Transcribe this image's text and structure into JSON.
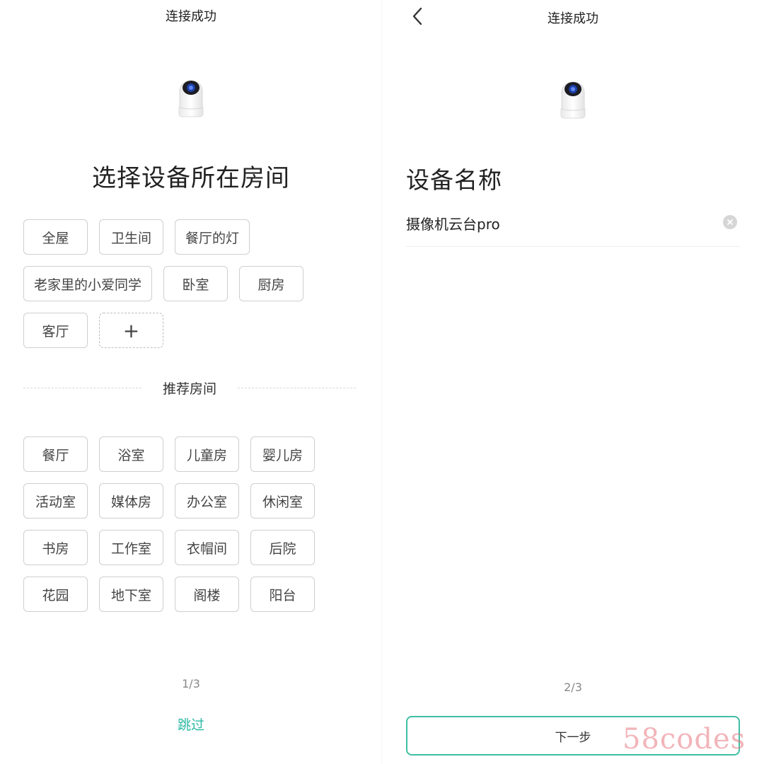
{
  "left_screen": {
    "title": "连接成功",
    "heading": "选择设备所在房间",
    "my_rooms": [
      "全屋",
      "卫生间",
      "餐厅的灯",
      "老家里的小爱同学",
      "卧室",
      "厨房",
      "客厅"
    ],
    "add_room_label": "+",
    "section_title": "推荐房间",
    "recommended_rooms": [
      "餐厅",
      "浴室",
      "儿童房",
      "婴儿房",
      "活动室",
      "媒体房",
      "办公室",
      "休闲室",
      "书房",
      "工作室",
      "衣帽间",
      "后院",
      "花园",
      "地下室",
      "阁楼",
      "阳台"
    ],
    "pager": "1/3",
    "skip_label": "跳过"
  },
  "right_screen": {
    "title": "连接成功",
    "heading": "设备名称",
    "device_name_value": "摄像机云台pro",
    "pager": "2/3",
    "next_label": "下一步"
  },
  "icons": {
    "back": "chevron-left-icon",
    "clear": "clear-x-icon",
    "device": "security-camera-icon"
  },
  "colors": {
    "accent": "#2bb9a3",
    "button_border": "#3fbfa3",
    "chip_border": "#cfcfcf"
  },
  "watermark": "58codes"
}
